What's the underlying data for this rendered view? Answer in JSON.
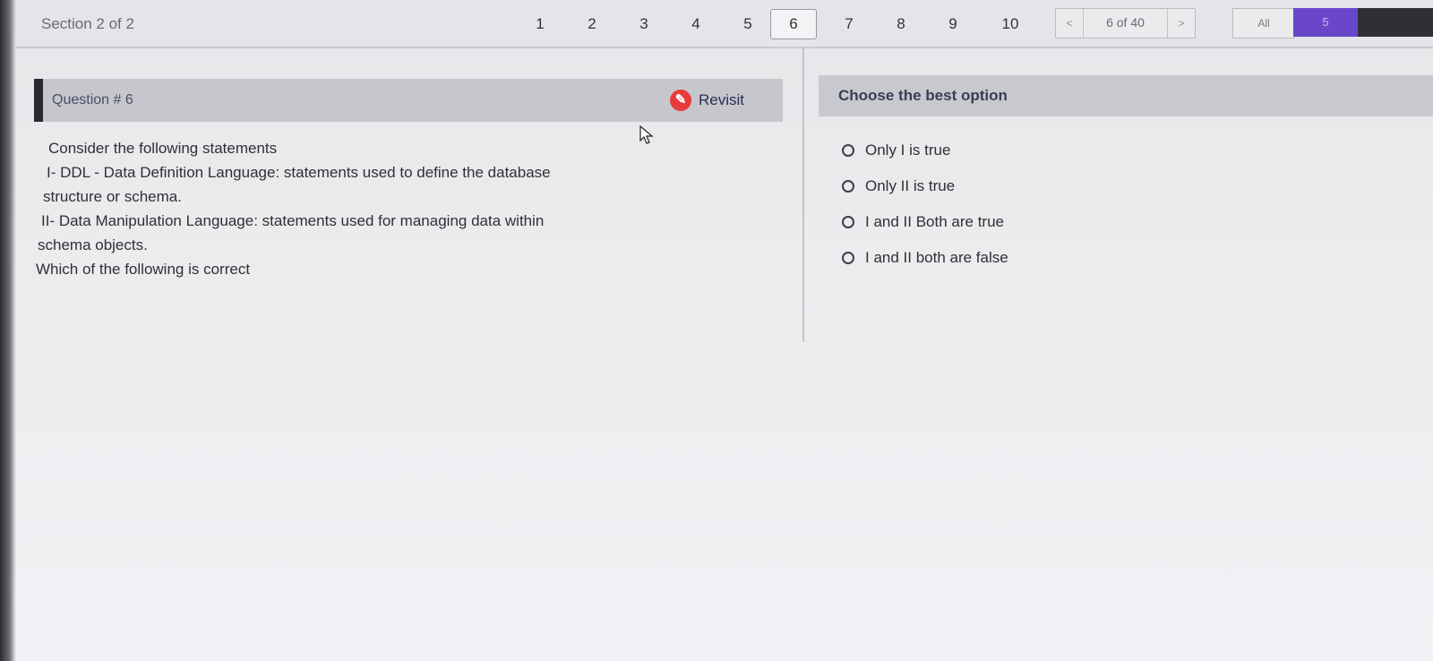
{
  "topbar": {
    "section_label": "Section 2 of 2",
    "question_numbers": [
      "1",
      "2",
      "3",
      "4",
      "5",
      "6",
      "7",
      "8",
      "9",
      "10"
    ],
    "active_question": "6",
    "pager": {
      "prev": "<",
      "count": "6 of 40",
      "next": ">"
    },
    "filter_all": "All",
    "filter_count": "5"
  },
  "question": {
    "title": "Question # 6",
    "revisit_label": "Revisit",
    "lines": [
      "Consider the following statements",
      "I- DDL - Data Definition Language: statements used to define the database",
      "structure or schema.",
      "II- Data Manipulation Language: statements used for managing data within",
      "schema objects.",
      "Which of the following is correct"
    ]
  },
  "answers": {
    "header": "Choose the best option",
    "options": [
      "Only I is true",
      "Only II is true",
      "I and II Both are true",
      "I and II both are false"
    ]
  },
  "colors": {
    "accent_purple": "#6a47c9",
    "revisit_red": "#e83b3b",
    "header_gray": "#c6c7cc"
  }
}
